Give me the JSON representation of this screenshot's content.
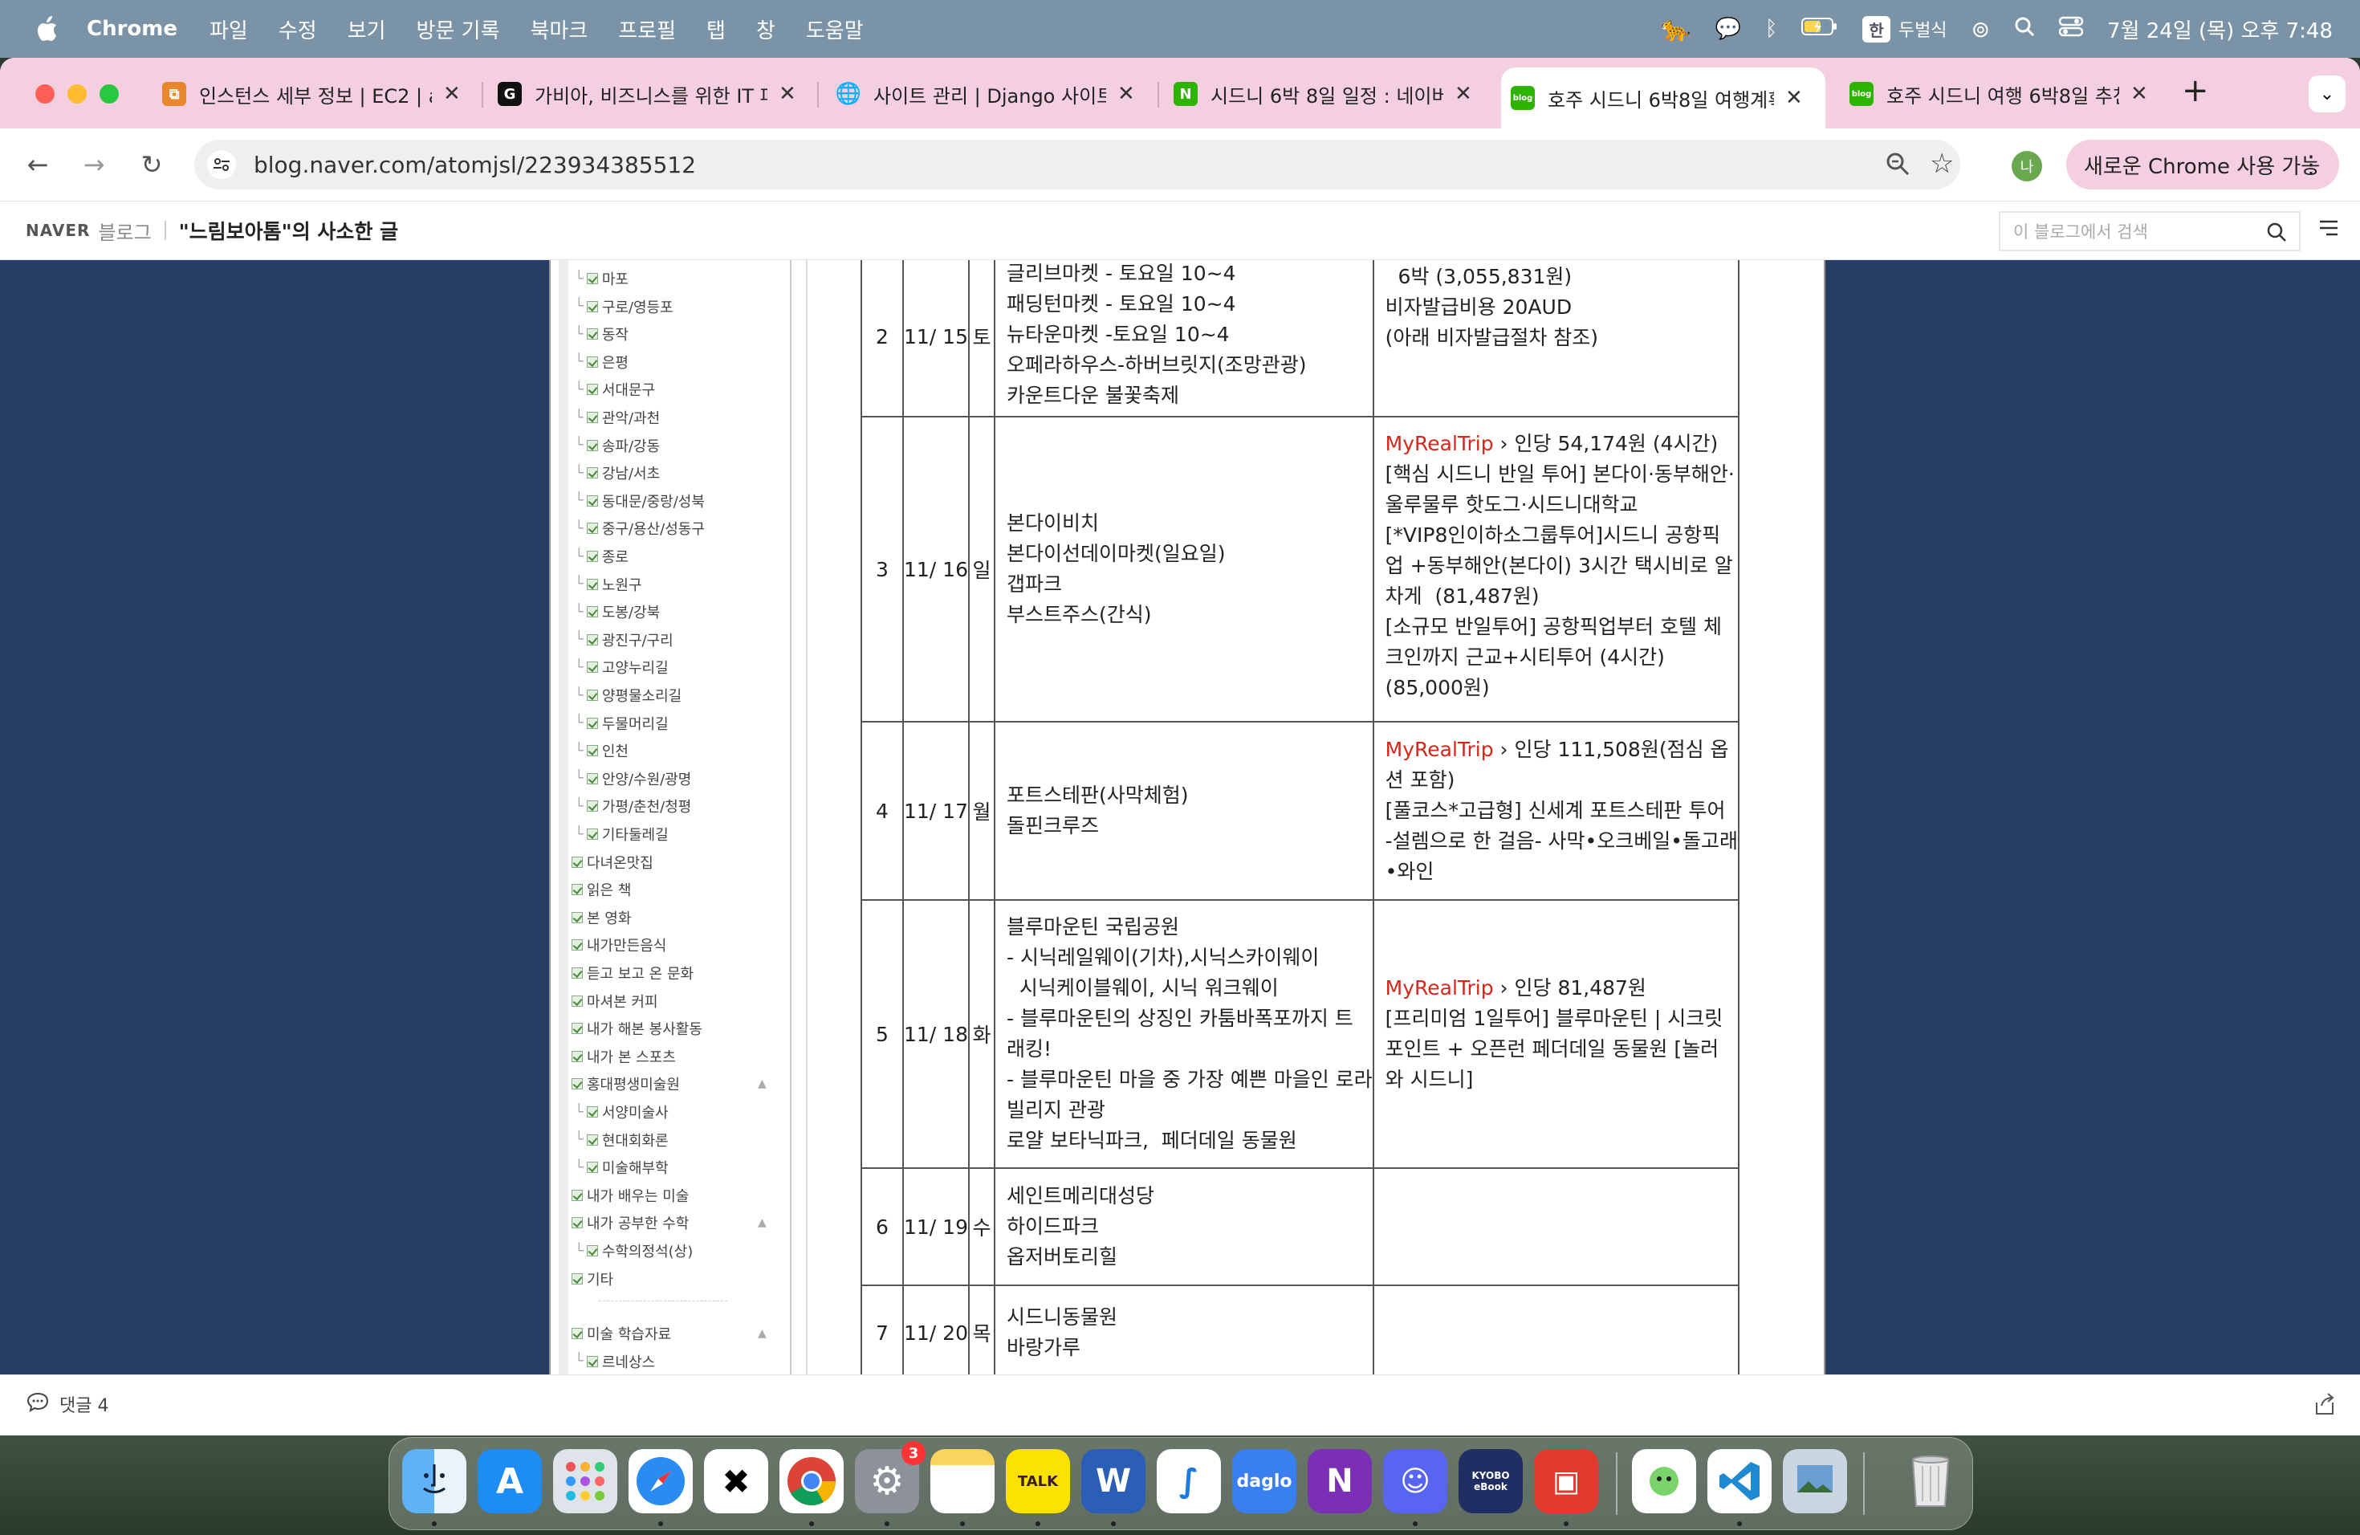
{
  "menubar": {
    "app": "Chrome",
    "menus": [
      "파일",
      "수정",
      "보기",
      "방문 기록",
      "북마크",
      "프로필",
      "탭",
      "창",
      "도움말"
    ],
    "ime": "한",
    "ime_name": "두벌식",
    "datetime": "7월 24일 (목) 오후 7:48"
  },
  "tabs": [
    {
      "title": "인스턴스 세부 정보 | EC2 | ap",
      "icon": "aws-icon"
    },
    {
      "title": "가비아, 비즈니스를 위한 IT 파",
      "icon": "gabia-icon"
    },
    {
      "title": "사이트 관리 | Django 사이트",
      "icon": "globe-icon"
    },
    {
      "title": "시드니 6박 8일 일정 : 네이버",
      "icon": "naver-icon"
    },
    {
      "title": "호주 시드니 6박8일 여행계획",
      "icon": "naver-blog-icon",
      "active": true
    },
    {
      "title": "호주 시드니 여행 6박8일 추천",
      "icon": "naver-blog-icon"
    }
  ],
  "toolbar": {
    "url": "blog.naver.com/atomjsl/223934385512",
    "profile_initial": "나",
    "update_label": "새로운 Chrome 사용 가능"
  },
  "blog": {
    "naver": "NAVER",
    "blog_label": "블로그",
    "title": "\"느림보아톰\"의 사소한 글",
    "search_placeholder": "이 블로그에서 검색"
  },
  "sidebar": {
    "items": [
      {
        "label": "마포",
        "level": 2
      },
      {
        "label": "구로/영등포",
        "level": 2
      },
      {
        "label": "동작",
        "level": 2
      },
      {
        "label": "은평",
        "level": 2
      },
      {
        "label": "서대문구",
        "level": 2
      },
      {
        "label": "관악/과천",
        "level": 2
      },
      {
        "label": "송파/강동",
        "level": 2
      },
      {
        "label": "강남/서초",
        "level": 2
      },
      {
        "label": "동대문/중랑/성북",
        "level": 2
      },
      {
        "label": "중구/용산/성동구",
        "level": 2
      },
      {
        "label": "종로",
        "level": 2
      },
      {
        "label": "노원구",
        "level": 2
      },
      {
        "label": "도봉/강북",
        "level": 2
      },
      {
        "label": "광진구/구리",
        "level": 2
      },
      {
        "label": "고양누리길",
        "level": 2
      },
      {
        "label": "양평물소리길",
        "level": 2
      },
      {
        "label": "두물머리길",
        "level": 2
      },
      {
        "label": "인천",
        "level": 2
      },
      {
        "label": "안양/수원/광명",
        "level": 2
      },
      {
        "label": "가평/춘천/청평",
        "level": 2
      },
      {
        "label": "기타둘레길",
        "level": 2
      },
      {
        "label": "다녀온맛집",
        "level": 1
      },
      {
        "label": "읽은 책",
        "level": 1
      },
      {
        "label": "본 영화",
        "level": 1
      },
      {
        "label": "내가만든음식",
        "level": 1
      },
      {
        "label": "듣고 보고 온 문화",
        "level": 1
      },
      {
        "label": "마셔본 커피",
        "level": 1
      },
      {
        "label": "내가 해본 봉사활동",
        "level": 1
      },
      {
        "label": "내가 본 스포츠",
        "level": 1
      },
      {
        "label": "홍대평생미술원",
        "level": 1,
        "caret": true
      },
      {
        "label": "서양미술사",
        "level": 2
      },
      {
        "label": "현대회화론",
        "level": 2
      },
      {
        "label": "미술해부학",
        "level": 2
      },
      {
        "label": "내가 배우는 미술",
        "level": 1
      },
      {
        "label": "내가 공부한 수학",
        "level": 1,
        "caret": true
      },
      {
        "label": "수학의정석(상)",
        "level": 2
      },
      {
        "label": "기타",
        "level": 1
      },
      {
        "label": "미술 학습자료",
        "level": 1,
        "caret": true,
        "gap": true
      },
      {
        "label": "르네상스",
        "level": 2
      }
    ]
  },
  "itinerary": [
    {
      "day": "2",
      "date": "11/ 15",
      "weekday": "토",
      "plan": [
        "글리브마켓 - 토요일 10~4",
        "패딩턴마켓 - 토요일 10~4",
        "뉴타운마켓 -토요일 10~4",
        "오페라하우스-하버브릿지(조망관광)",
        "카운트다운 불꽃축제"
      ],
      "info": [
        "  6박 (3,055,831원)",
        "비자발급비용 20AUD",
        "(아래 비자발급절차 참조)"
      ]
    },
    {
      "day": "3",
      "date": "11/ 16",
      "weekday": "일",
      "plan": [
        "본다이비치",
        "본다이선데이마켓(일요일)",
        "갭파크",
        "부스트주스(간식)"
      ],
      "info_link": "MyRealTrip",
      "info_first": " 인당 54,174원  (4시간)",
      "info": [
        "[핵심 시드니 반일 투어] 본다이·동부해안·",
        "울루물루 핫도그·시드니대학교",
        "[*VIP8인이하소그룹투어]시드니 공항픽",
        "업 +동부해안(본다이) 3시간 택시비로 알",
        "차게  (81,487원)",
        "[소규모 반일투어] 공항픽업부터 호텔 체",
        "크인까지 근교+시티투어 (4시간)",
        "(85,000원)"
      ]
    },
    {
      "day": "4",
      "date": "11/ 17",
      "weekday": "월",
      "plan": [
        "포트스테판(사막체험)",
        "돌핀크루즈"
      ],
      "info_link": "MyRealTrip",
      "info_first": " 인당 111,508원(점심 옵",
      "info": [
        "션 포함)",
        "[풀코스*고급형] 신세계 포트스테판 투어",
        "-설렘으로 한 걸음- 사막•오크베일•돌고래",
        "•와인"
      ]
    },
    {
      "day": "5",
      "date": "11/ 18",
      "weekday": "화",
      "plan": [
        "블루마운틴 국립공원",
        "- 시닉레일웨이(기차),시닉스카이웨이",
        "  시닉케이블웨이, 시닉 워크웨이",
        "- 블루마운틴의 상징인 카툼바폭포까지 트",
        "래킹!",
        "- 블루마운틴 마을 중 가장 예쁜 마을인 로라",
        "빌리지 관광",
        "로얄 보타닉파크,  페더데일 동물원"
      ],
      "info_link": "MyRealTrip",
      "info_first": " 인당 81,487원",
      "info": [
        "[프리미엄 1일투어] 블루마운틴 | 시크릿",
        "포인트 + 오픈런 페더데일 동물원 [놀러",
        "와 시드니]"
      ]
    },
    {
      "day": "6",
      "date": "11/ 19",
      "weekday": "수",
      "plan": [
        "세인트메리대성당",
        "하이드파크",
        "옵저버토리힐"
      ],
      "info": []
    },
    {
      "day": "7",
      "date": "11/ 20",
      "weekday": "목",
      "plan": [
        "시드니동물원",
        "바랑가루"
      ],
      "info": []
    }
  ],
  "footer": {
    "comments": "댓글 4"
  },
  "dock": {
    "apps": [
      "Finder",
      "App Store",
      "Launchpad",
      "Safari",
      "Capcut",
      "Chrome",
      "System Settings",
      "Notes",
      "KakaoTalk",
      "Word",
      "Freeform",
      "Daglo",
      "OneNote",
      "Discord",
      "Kyobo eBook",
      "Photo Booth",
      "Tasks",
      "VS Code",
      "Preview",
      "Trash"
    ],
    "badge": "3",
    "talk_label": "TALK",
    "daglo_label": "daglo",
    "kyobo_label": "KYOBO eBook"
  },
  "colors": {
    "menubar": "#7b93a6",
    "tabstrip": "#f4cfe0",
    "blog_bg": "#283d63",
    "myrealtrip": "#d6261a"
  }
}
